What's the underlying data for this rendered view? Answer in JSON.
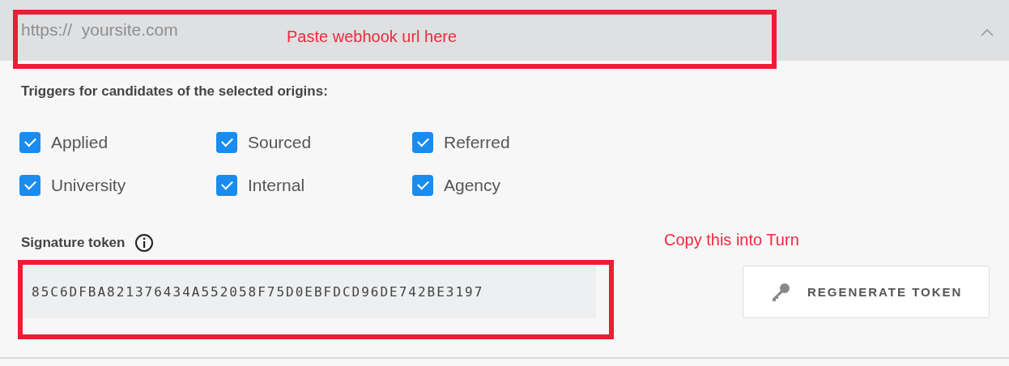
{
  "webhook_field": {
    "placeholder": "https://  yoursite.com",
    "expanded": true
  },
  "triggers": {
    "heading": "Triggers for candidates of the selected origins:",
    "origins": [
      {
        "label": "Applied",
        "checked": true
      },
      {
        "label": "Sourced",
        "checked": true
      },
      {
        "label": "Referred",
        "checked": true
      },
      {
        "label": "University",
        "checked": true
      },
      {
        "label": "Internal",
        "checked": true
      },
      {
        "label": "Agency",
        "checked": true
      }
    ]
  },
  "signature": {
    "label": "Signature token",
    "token": "85C6DFBA821376434A552058F75D0EBFDCD96DE742BE3197",
    "button": "REGENERATE TOKEN"
  },
  "annotations": [
    {
      "text": "Paste webhook url here"
    },
    {
      "text": "Copy this into Turn"
    }
  ]
}
